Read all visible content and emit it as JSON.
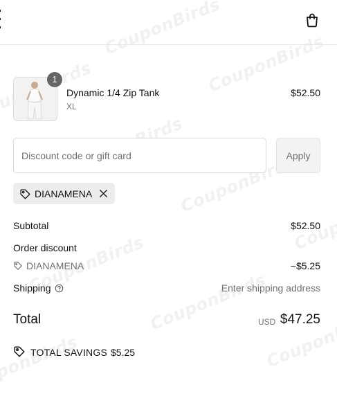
{
  "header": {
    "menu_icon": "menu-icon",
    "bag_icon": "shopping-bag-icon"
  },
  "line_item": {
    "quantity": "1",
    "name": "Dynamic 1/4 Zip Tank",
    "variant": "XL",
    "price": "$52.50",
    "image_icon": "product-thumbnail"
  },
  "discount": {
    "placeholder": "Discount code or gift card",
    "apply_label": "Apply",
    "applied_code": "DIANAMENA",
    "tag_icon": "tag-icon",
    "remove_icon": "close-icon"
  },
  "summary": {
    "subtotal_label": "Subtotal",
    "subtotal_value": "$52.50",
    "order_discount_label": "Order discount",
    "discount_code": "DIANAMENA",
    "discount_value": "−$5.25",
    "shipping_label": "Shipping",
    "shipping_value": "Enter shipping address",
    "total_label": "Total",
    "currency": "USD",
    "total_value": "$47.25",
    "savings_label": "TOTAL SAVINGS",
    "savings_value": "$5.25"
  },
  "watermark": {
    "text": "CouponBirds"
  },
  "colors": {
    "text": "#1a1a1a",
    "muted": "#707070",
    "chip_bg": "#ededed",
    "badge": "#666666"
  }
}
